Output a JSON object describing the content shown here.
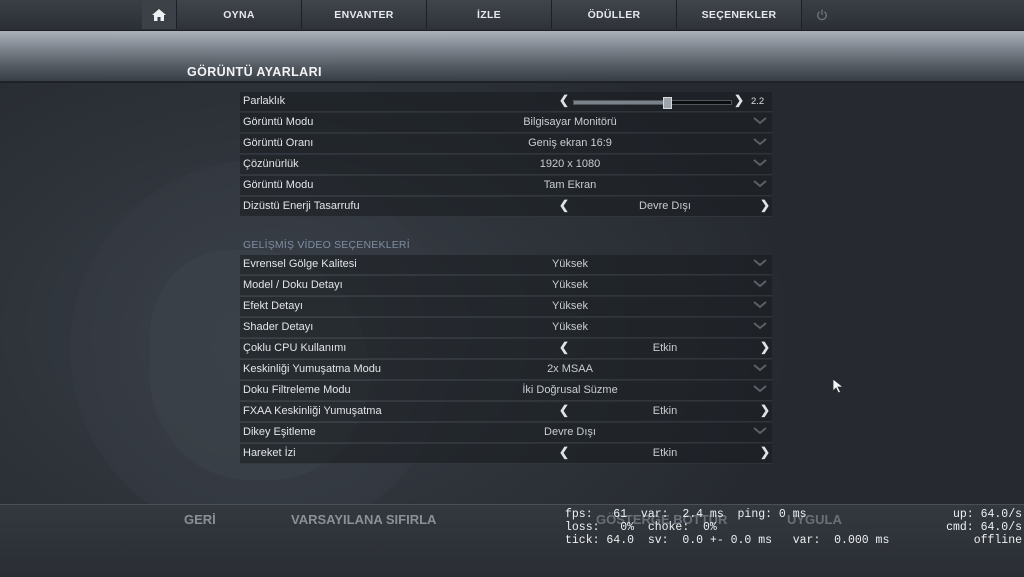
{
  "nav": {
    "items": [
      "OYNA",
      "ENVANTER",
      "İZLE",
      "ÖDÜLLER",
      "SEÇENEKLER"
    ]
  },
  "page": {
    "title": "GÖRÜNTÜ AYARLARI"
  },
  "brightness": {
    "label": "Parlaklık",
    "value": "2.2",
    "level": 0.59
  },
  "basic_rows": [
    {
      "label": "Görüntü Modu",
      "value": "Bilgisayar Monitörü",
      "control": "dropdown"
    },
    {
      "label": "Görüntü Oranı",
      "value": "Geniş ekran 16:9",
      "control": "dropdown"
    },
    {
      "label": "Çözünürlük",
      "value": "1920 x 1080",
      "control": "dropdown"
    },
    {
      "label": "Görüntü Modu",
      "value": "Tam Ekran",
      "control": "dropdown"
    },
    {
      "label": "Dizüstü Enerji Tasarrufu",
      "value": "Devre Dışı",
      "control": "toggle"
    }
  ],
  "advanced": {
    "title": "GELİŞMİŞ VİDEO SEÇENEKLERİ",
    "rows": [
      {
        "label": "Evrensel Gölge Kalitesi",
        "value": "Yüksek",
        "control": "dropdown"
      },
      {
        "label": "Model / Doku Detayı",
        "value": "Yüksek",
        "control": "dropdown"
      },
      {
        "label": "Efekt Detayı",
        "value": "Yüksek",
        "control": "dropdown"
      },
      {
        "label": "Shader Detayı",
        "value": "Yüksek",
        "control": "dropdown"
      },
      {
        "label": "Çoklu CPU Kullanımı",
        "value": "Etkin",
        "control": "toggle"
      },
      {
        "label": "Keskinliği Yumuşatma Modu",
        "value": "2x MSAA",
        "control": "dropdown"
      },
      {
        "label": "Doku Filtreleme Modu",
        "value": "İki Doğrusal Süzme",
        "control": "dropdown"
      },
      {
        "label": "FXAA Keskinliği Yumuşatma",
        "value": "Etkin",
        "control": "toggle"
      },
      {
        "label": "Dikey Eşitleme",
        "value": "Devre Dışı",
        "control": "dropdown"
      },
      {
        "label": "Hareket İzi",
        "value": "Etkin",
        "control": "toggle"
      }
    ]
  },
  "bottom": {
    "back": "GERİ",
    "reset": "VARSAYILANA SIFIRLA",
    "show": "GÖSTERGE BOTTUR",
    "apply": "UYGULA"
  },
  "netgraph": {
    "left": "fps:   61  var:  2.4 ms  ping: 0 ms\nloss:   0%  choke:  0%\ntick: 64.0  sv:  0.0 +- 0.0 ms   var:  0.000 ms",
    "right": "up: 64.0/s\ncmd: 64.0/s\noffline"
  }
}
